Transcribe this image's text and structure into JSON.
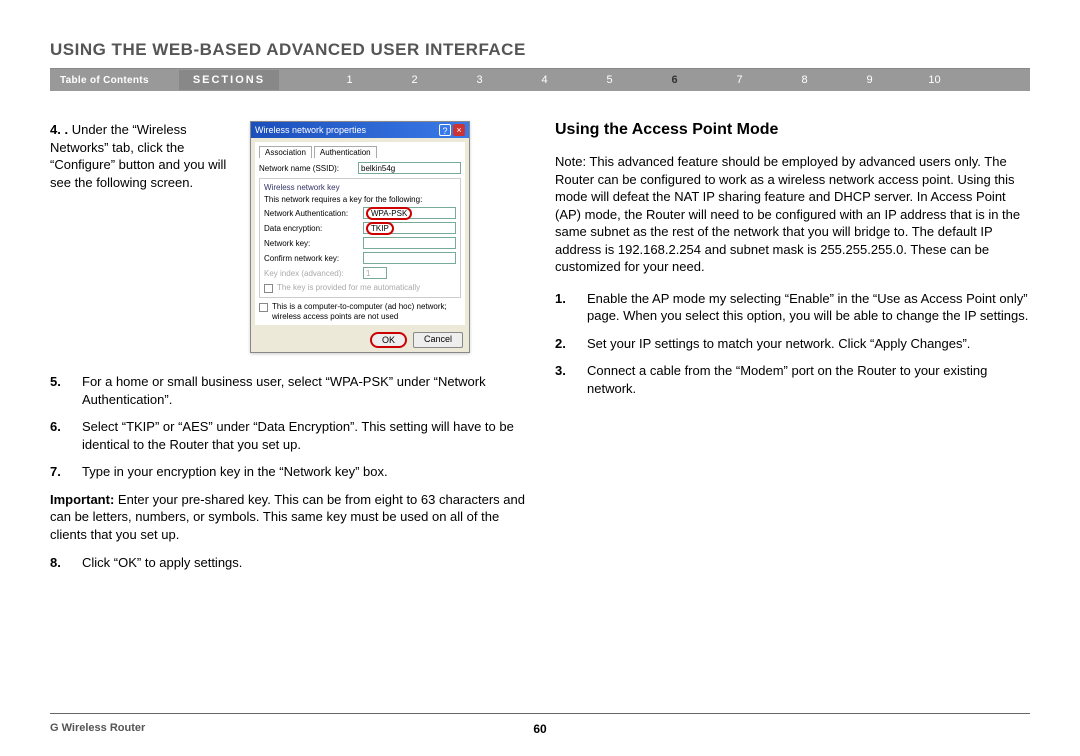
{
  "header": {
    "title": "USING THE WEB-BASED ADVANCED USER INTERFACE"
  },
  "nav": {
    "toc": "Table of Contents",
    "sections_label": "SECTIONS",
    "items": [
      "1",
      "2",
      "3",
      "4",
      "5",
      "6",
      "7",
      "8",
      "9",
      "10"
    ],
    "active": "6"
  },
  "left": {
    "intro_num": "4. .",
    "intro_text": "Under the “Wireless Networks” tab, click the “Configure” button and you will see the following screen.",
    "dialog": {
      "title": "Wireless network properties",
      "tab1": "Association",
      "tab2": "Authentication",
      "ssid_label": "Network name (SSID):",
      "ssid_value": "belkin54g",
      "group_title": "Wireless network key",
      "req_text": "This network requires a key for the following:",
      "auth_label": "Network Authentication:",
      "auth_value": "WPA-PSK",
      "enc_label": "Data encryption:",
      "enc_value": "TKIP",
      "key_label": "Network key:",
      "confirm_label": "Confirm network key:",
      "index_label": "Key index (advanced):",
      "index_value": "1",
      "auto_text": "The key is provided for me automatically",
      "adhoc_text": "This is a computer-to-computer (ad hoc) network; wireless access points are not used",
      "ok": "OK",
      "cancel": "Cancel"
    },
    "items": [
      {
        "num": "5.",
        "text": "For a home or small business user, select “WPA-PSK” under “Network Authentication”."
      },
      {
        "num": "6.",
        "text": "Select “TKIP” or “AES” under “Data Encryption”. This setting will have to be identical to the Router that you set up."
      },
      {
        "num": "7.",
        "text": "Type in your encryption key in the “Network key” box."
      }
    ],
    "important_label": "Important:",
    "important_text": " Enter your pre-shared key. This can be from eight to 63 characters and can be letters, numbers, or symbols. This same key must be used on all of the clients that you set up.",
    "item8_num": "8.",
    "item8_text": "Click “OK” to apply settings."
  },
  "right": {
    "heading": "Using the Access Point Mode",
    "note": "Note: This advanced feature should be employed by advanced users only. The Router can be configured to work as a wireless network access point. Using this mode will defeat the NAT IP sharing feature and DHCP server. In Access Point (AP) mode, the Router will need to be configured with an IP address that is in the same subnet as the rest of the network that you will bridge to. The default IP address is 192.168.2.254 and subnet mask is 255.255.255.0. These can be customized for your need.",
    "items": [
      {
        "num": "1.",
        "text": "Enable the AP mode my selecting “Enable” in the “Use as Access Point only” page. When you select this option, you will be able to change the IP settings."
      },
      {
        "num": "2.",
        "text": "Set your IP settings to match your network. Click “Apply Changes”."
      },
      {
        "num": "3.",
        "text": "Connect a cable from the “Modem” port on the Router to your existing network."
      }
    ]
  },
  "footer": {
    "product": "G Wireless Router",
    "page": "60"
  }
}
